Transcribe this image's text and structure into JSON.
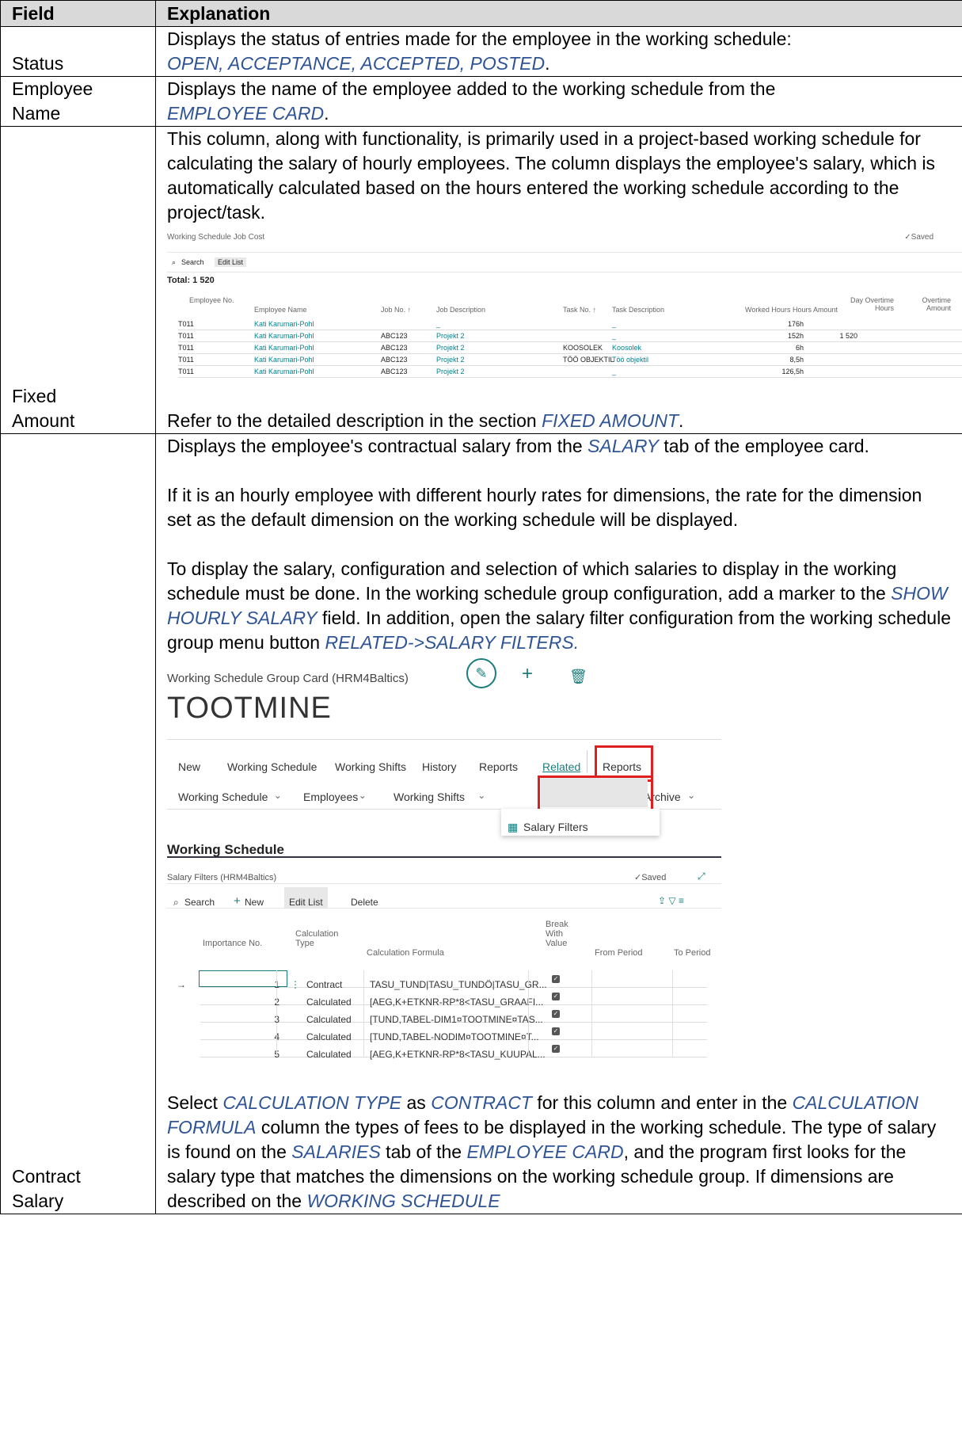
{
  "table": {
    "header": {
      "field": "Field",
      "explanation": "Explanation"
    },
    "status": {
      "field": "Status",
      "line1": "Displays the status of entries made for the employee in the working schedule:",
      "kw": "OPEN, ACCEPTANCE, ACCEPTED, POSTED",
      "end": "."
    },
    "employee_name": {
      "field_l1": "Employee",
      "field_l2": "Name",
      "line1": "Displays the name of the employee added to the working schedule from the",
      "kw": "EMPLOYEE CARD",
      "end": "."
    },
    "fixed_amount": {
      "field_l1": "Fixed",
      "field_l2": "Amount",
      "para": "This column, along with functionality, is primarily used in a project-based working schedule for calculating the salary of hourly employees. The column displays the employee's salary, which is automatically calculated based on the hours entered the working schedule according to the project/task.",
      "ref_pre": "Refer to the detailed description in the section ",
      "ref_kw": "FIXED AMOUNT",
      "ref_end": "."
    },
    "contract_salary": {
      "field_l1": "Contract",
      "field_l2": "Salary",
      "p1_pre": "Displays the employee's contractual salary from the ",
      "p1_kw": "SALARY",
      "p1_post": " tab of the employee card.",
      "p2": "If it is an hourly employee with different hourly rates for dimensions, the rate for the dimension set as the default dimension on the working schedule will be displayed.",
      "p3_a": "To display the salary, configuration and selection of which salaries to display in the working schedule must be done. In the working schedule group configuration, add a marker to the ",
      "p3_kw1": "SHOW HOURLY SALARY",
      "p3_b": " field. In addition, open the salary filter configuration from the working schedule group menu button ",
      "p3_kw2": "RELATED->SALARY FILTERS.",
      "p4_a": "Select ",
      "p4_kw1": "CALCULATION TYPE",
      "p4_b": " as ",
      "p4_kw2": "CONTRACT",
      "p4_c": " for this column and enter in the ",
      "p4_kw3": "CALCULATION FORMULA",
      "p4_d": " column the types of fees to be displayed in the working schedule. The type of salary is found on the ",
      "p4_kw4": "SALARIES",
      "p4_e": " tab of the ",
      "p4_kw5": "EMPLOYEE CARD",
      "p4_f": ", and the program first looks for the salary type that matches the dimensions on the working schedule group. If dimensions are described on the ",
      "p4_kw6": "WORKING SCHEDULE"
    }
  },
  "shot1": {
    "title": "Working Schedule Job Cost",
    "saved": "✓Saved",
    "search": "Search",
    "edit_list": "Edit List",
    "total": "Total: 1 520",
    "headers": {
      "emp_no": "Employee No.",
      "emp_name": "Employee Name",
      "job_no": "Job No. ↑",
      "job_desc": "Job Description",
      "task_no": "Task No. ↑",
      "task_desc": "Task Description",
      "worked": "Worked Hours",
      "hours_amount": "Hours Amount",
      "day_ot": "Day Overtime Hours",
      "ot_amount": "Overtime Amount"
    },
    "rows": [
      {
        "emp": "T011",
        "name": "Kati Karumari-Pohl",
        "job": "",
        "jdesc": "_",
        "task": "",
        "tdesc": "_",
        "worked": "176h",
        "amount": ""
      },
      {
        "emp": "T011",
        "name": "Kati Karumari-Pohl",
        "job": "ABC123",
        "jdesc": "Projekt 2",
        "task": "",
        "tdesc": "_",
        "worked": "152h",
        "amount": "1 520"
      },
      {
        "emp": "T011",
        "name": "Kati Karumari-Pohl",
        "job": "ABC123",
        "jdesc": "Projekt 2",
        "task": "KOOSOLEK",
        "tdesc": "Koosolek",
        "worked": "6h",
        "amount": ""
      },
      {
        "emp": "T011",
        "name": "Kati Karumari-Pohl",
        "job": "ABC123",
        "jdesc": "Projekt 2",
        "task": "TÖÖ OBJEKTIL",
        "tdesc": "Töö objektil",
        "worked": "8,5h",
        "amount": ""
      },
      {
        "emp": "T011",
        "name": "Kati Karumari-Pohl",
        "job": "ABC123",
        "jdesc": "Projekt 2",
        "task": "",
        "tdesc": "_",
        "worked": "126,5h",
        "amount": ""
      }
    ]
  },
  "shot2": {
    "card_title": "Working Schedule Group Card (HRM4Baltics)",
    "heading": "TOOTMINE",
    "menu1": [
      "New",
      "Working Schedule",
      "Working Shifts",
      "History",
      "Reports",
      "Related",
      "Reports"
    ],
    "menu2": [
      "Working Schedule",
      "Employees",
      "Working Shifts",
      "Salary Filters",
      "Archive"
    ],
    "dropdown_item": "Salary Filters",
    "section": "Working Schedule",
    "sub_title": "Salary Filters (HRM4Baltics)",
    "saved": "✓Saved",
    "toolbar": {
      "search": "Search",
      "new": "New",
      "edit_list": "Edit List",
      "delete": "Delete"
    },
    "headers": {
      "importance": "Importance No.",
      "calc_type": "Calculation Type",
      "formula": "Calculation Formula",
      "break": "Break With Value",
      "from": "From Period",
      "to": "To Period"
    },
    "rows": [
      {
        "no": "1",
        "type": "Contract",
        "formula": "TASU_TUND|TASU_TUNDÖ|TASU_GR..."
      },
      {
        "no": "2",
        "type": "Calculated",
        "formula": "[AEG,K+ETKNR-RP*8<TASU_GRAAFI..."
      },
      {
        "no": "3",
        "type": "Calculated",
        "formula": "[TUND,TABEL-DIM1¤TOOTMINE¤TAS..."
      },
      {
        "no": "4",
        "type": "Calculated",
        "formula": "[TUND,TABEL-NODIM¤TOOTMINE¤T..."
      },
      {
        "no": "5",
        "type": "Calculated",
        "formula": "[AEG,K+ETKNR-RP*8<TASU_KUUPAL..."
      }
    ]
  }
}
